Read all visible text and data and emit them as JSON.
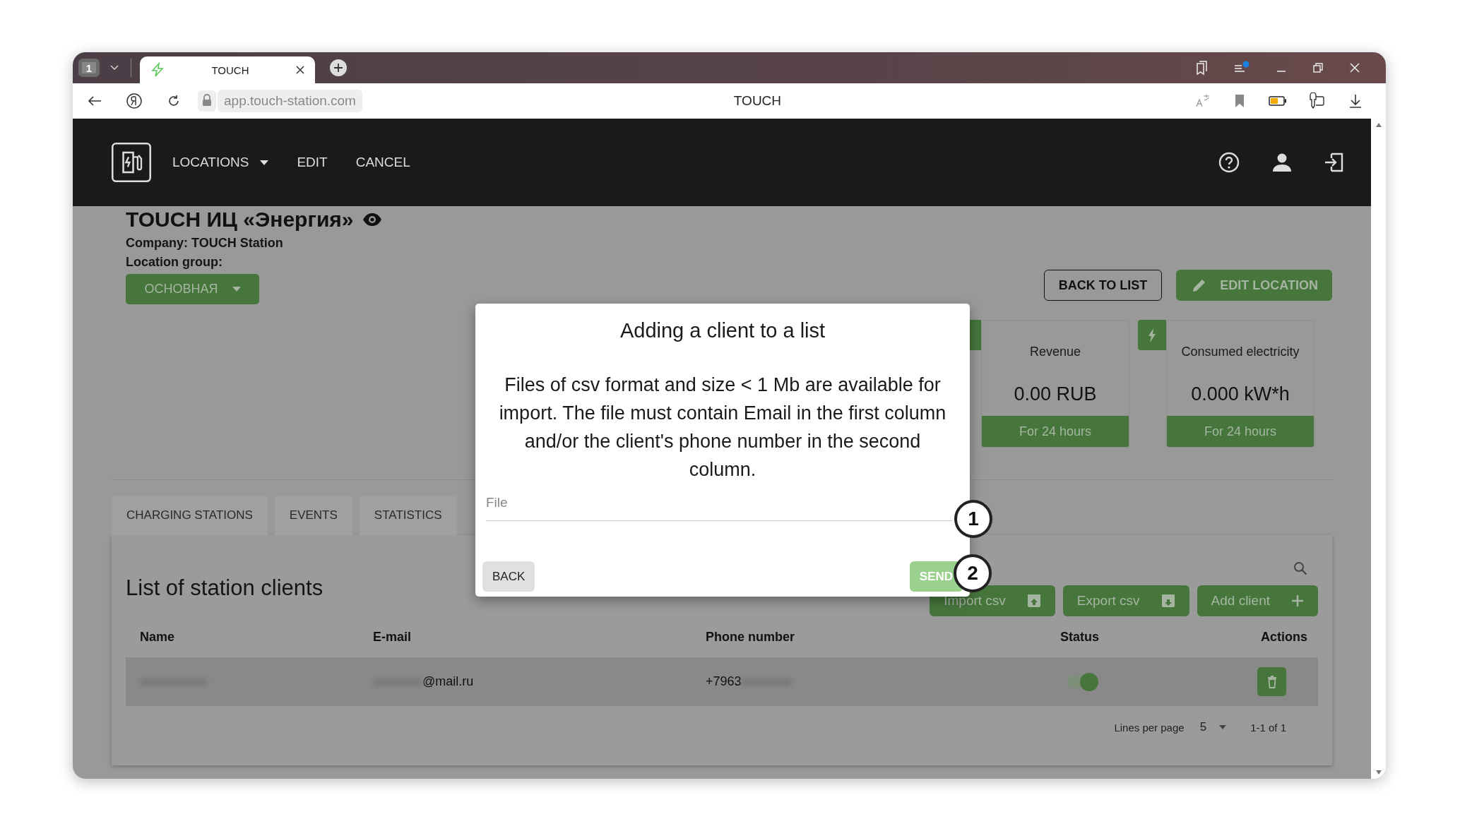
{
  "browser": {
    "tab_count": "1",
    "tab_title": "TOUCH",
    "url": "app.touch-station.com",
    "page_title": "TOUCH"
  },
  "nav": [
    {
      "label": "LOCATIONS",
      "kind": "dropdown"
    },
    {
      "label": "EDIT",
      "kind": "link"
    },
    {
      "label": "CANCEL",
      "kind": "link"
    }
  ],
  "location": {
    "title": "TOUCH ИЦ «Энергия»",
    "company": "Company: TOUCH Station",
    "group_label": "Location group:",
    "group": "ОСНОВНАЯ"
  },
  "actions": [
    {
      "label": "BACK TO LIST",
      "kind": "outline"
    },
    {
      "label": "EDIT LOCATION",
      "kind": "edit"
    }
  ],
  "stats": [
    {
      "title": "Revenue",
      "value": "0.00 RUB",
      "period": "For 24 hours"
    },
    {
      "title": "Consumed electricity",
      "value": "0.000 kW*h",
      "period": "For 24 hours"
    }
  ],
  "tabs": [
    {
      "label": "CHARGING STATIONS",
      "selected": false
    },
    {
      "label": "EVENTS",
      "selected": false
    },
    {
      "label": "STATISTICS",
      "selected": false
    }
  ],
  "clients": {
    "title": "List of station clients",
    "buttons": [
      {
        "label": "Import csv",
        "kind": "import"
      },
      {
        "label": "Export csv",
        "kind": "export"
      },
      {
        "label": "Add client",
        "kind": "add"
      }
    ],
    "columns": [
      "Name",
      "E-mail",
      "Phone number",
      "Status",
      "Actions"
    ],
    "rows": [
      {
        "email": "@mail.ru",
        "phone": "+7963",
        "on": true
      }
    ],
    "pagination": {
      "label": "Lines per page",
      "per_page": "5",
      "range": "1-1 of 1"
    }
  },
  "dialog": {
    "title": "Adding a client to a list",
    "text": "Files of csv format and size < 1 Mb are available for import. The file must contain Email in the first column and/or the client's phone number in the second column.",
    "placeholder": "File",
    "buttons": [
      {
        "label": "BACK",
        "kind": "secondary",
        "disabled": false
      },
      {
        "label": "SEND",
        "kind": "primary",
        "disabled": true
      }
    ]
  },
  "callouts": [
    "1",
    "2"
  ]
}
